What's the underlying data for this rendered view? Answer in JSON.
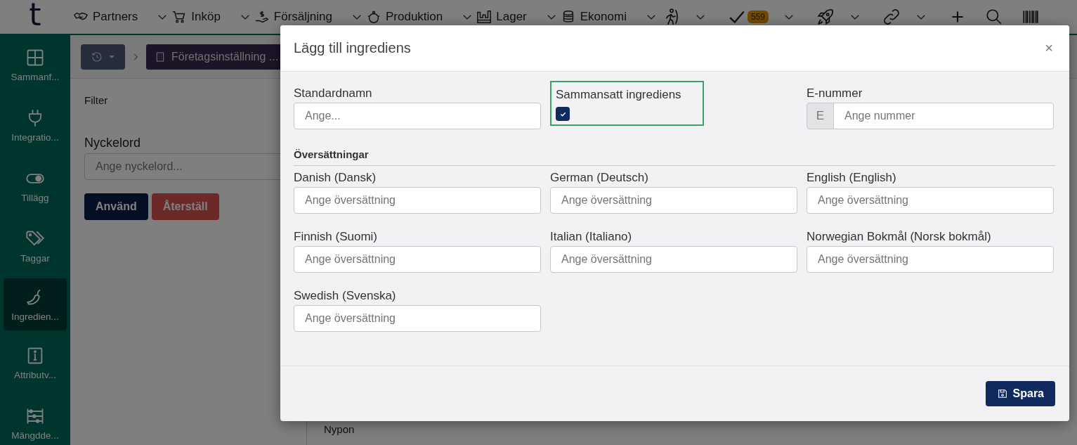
{
  "nav": {
    "logo": "t",
    "menus": [
      {
        "label": "Partners"
      },
      {
        "label": "Inköp"
      },
      {
        "label": "Försäljning"
      },
      {
        "label": "Produktion"
      },
      {
        "label": "Lager"
      },
      {
        "label": "Ekonomi"
      }
    ],
    "badge": "559"
  },
  "sidebar": {
    "items": [
      {
        "label": "Sammanf...",
        "selected": false
      },
      {
        "label": "Integratio...",
        "selected": false
      },
      {
        "label": "Tillägg",
        "selected": false
      },
      {
        "label": "Taggar",
        "selected": false
      },
      {
        "label": "Ingredien...",
        "selected": true
      },
      {
        "label": "Attributv...",
        "selected": false
      },
      {
        "label": "Mängdde...",
        "selected": false
      }
    ]
  },
  "breadcrumb": {
    "current": "Företagsinställning ..."
  },
  "filter": {
    "title": "Filter",
    "keyword_label": "Nyckelord",
    "keyword_placeholder": "Ange nyckelord...",
    "apply": "Använd",
    "reset": "Återställ"
  },
  "list": {
    "rows": [
      "Nypon"
    ]
  },
  "modal": {
    "title": "Lägg till ingrediens",
    "close": "×",
    "standard_name": {
      "label": "Standardnamn",
      "placeholder": "Ange..."
    },
    "composite": {
      "label": "Sammansatt ingrediens",
      "checked": true
    },
    "e_number": {
      "label": "E-nummer",
      "prefix": "E",
      "placeholder": "Ange nummer"
    },
    "translations_heading": "Översättningar",
    "translations": [
      {
        "label": "Danish (Dansk)",
        "placeholder": "Ange översättning"
      },
      {
        "label": "German (Deutsch)",
        "placeholder": "Ange översättning"
      },
      {
        "label": "English (English)",
        "placeholder": "Ange översättning"
      },
      {
        "label": "Finnish (Suomi)",
        "placeholder": "Ange översättning"
      },
      {
        "label": "Italian (Italiano)",
        "placeholder": "Ange översättning"
      },
      {
        "label": "Norwegian Bokmål (Norsk bokmål)",
        "placeholder": "Ange översättning"
      },
      {
        "label": "Swedish (Svenska)",
        "placeholder": "Ange översättning"
      }
    ],
    "save": "Spara"
  }
}
